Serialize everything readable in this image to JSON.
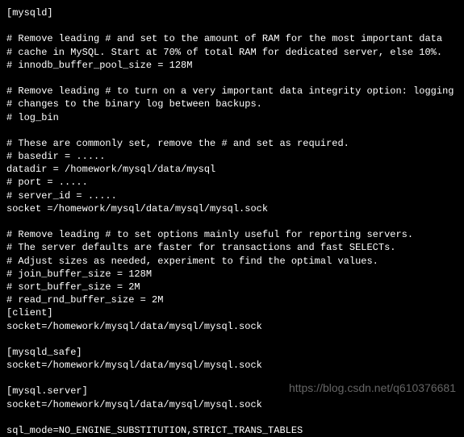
{
  "lines": [
    "[mysqld]",
    "",
    "# Remove leading # and set to the amount of RAM for the most important data",
    "# cache in MySQL. Start at 70% of total RAM for dedicated server, else 10%.",
    "# innodb_buffer_pool_size = 128M",
    "",
    "# Remove leading # to turn on a very important data integrity option: logging",
    "# changes to the binary log between backups.",
    "# log_bin",
    "",
    "# These are commonly set, remove the # and set as required.",
    "# basedir = .....",
    "datadir = /homework/mysql/data/mysql",
    "# port = .....",
    "# server_id = .....",
    "socket =/homework/mysql/data/mysql/mysql.sock",
    "",
    "# Remove leading # to set options mainly useful for reporting servers.",
    "# The server defaults are faster for transactions and fast SELECTs.",
    "# Adjust sizes as needed, experiment to find the optimal values.",
    "# join_buffer_size = 128M",
    "# sort_buffer_size = 2M",
    "# read_rnd_buffer_size = 2M",
    "[client]",
    "socket=/homework/mysql/data/mysql/mysql.sock",
    "",
    "[mysqld_safe]",
    "socket=/homework/mysql/data/mysql/mysql.sock",
    "",
    "[mysql.server]",
    "socket=/homework/mysql/data/mysql/mysql.sock",
    "",
    "sql_mode=NO_ENGINE_SUBSTITUTION,STRICT_TRANS_TABLES"
  ],
  "watermark": "https://blog.csdn.net/q610376681"
}
